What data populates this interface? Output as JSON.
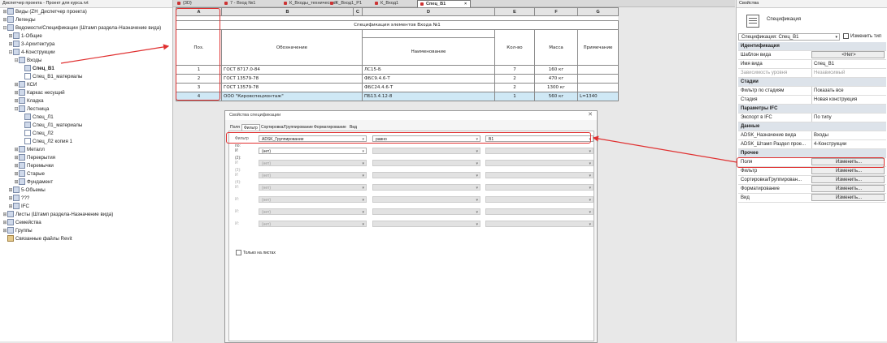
{
  "browser": {
    "title": "Диспетчер проекта - Проект для курса.rvt",
    "items": [
      {
        "label": "Виды (ZH_Диспетчер проекта)",
        "toggle": "⊞",
        "indent": 0
      },
      {
        "label": "Легенды",
        "toggle": "⊞",
        "indent": 0
      },
      {
        "label": "Ведомости/Спецификации (Штамп раздела-Назначение вида)",
        "toggle": "⊟",
        "indent": 0
      },
      {
        "label": "1-Общие",
        "toggle": "⊞",
        "indent": 1
      },
      {
        "label": "3-Архитектура",
        "toggle": "⊞",
        "indent": 1
      },
      {
        "label": "4-Конструкции",
        "toggle": "⊟",
        "indent": 1
      },
      {
        "label": "Входы",
        "toggle": "⊟",
        "indent": 2
      },
      {
        "label": "Спец_В1",
        "toggle": "",
        "indent": 3
      },
      {
        "label": "Спец_В1_материалы",
        "toggle": "",
        "indent": 3
      },
      {
        "label": "КСИ",
        "toggle": "⊞",
        "indent": 2
      },
      {
        "label": "Каркас несущий",
        "toggle": "⊞",
        "indent": 2
      },
      {
        "label": "Кладка",
        "toggle": "⊞",
        "indent": 2
      },
      {
        "label": "Лестница",
        "toggle": "⊟",
        "indent": 2
      },
      {
        "label": "Спец_Л1",
        "toggle": "",
        "indent": 3
      },
      {
        "label": "Спец_Л1_материалы",
        "toggle": "",
        "indent": 3
      },
      {
        "label": "Спец_Л2",
        "toggle": "",
        "indent": 3
      },
      {
        "label": "Спец_Л2 копия 1",
        "toggle": "",
        "indent": 3
      },
      {
        "label": "Металл",
        "toggle": "⊞",
        "indent": 2
      },
      {
        "label": "Перекрытия",
        "toggle": "⊞",
        "indent": 2
      },
      {
        "label": "Перемычки",
        "toggle": "⊞",
        "indent": 2
      },
      {
        "label": "Старые",
        "toggle": "⊞",
        "indent": 2
      },
      {
        "label": "Фундамент",
        "toggle": "⊞",
        "indent": 2
      },
      {
        "label": "5-Объемы",
        "toggle": "⊞",
        "indent": 1
      },
      {
        "label": "???",
        "toggle": "⊞",
        "indent": 1
      },
      {
        "label": "IFC",
        "toggle": "⊞",
        "indent": 1
      },
      {
        "label": "Листы (Штамп раздела-Назначение вида)",
        "toggle": "⊞",
        "indent": 0
      },
      {
        "label": "Семейства",
        "toggle": "⊞",
        "indent": 0
      },
      {
        "label": "Группы",
        "toggle": "⊞",
        "indent": 0
      },
      {
        "label": "Связанные файлы Revit",
        "toggle": "",
        "indent": 0
      }
    ]
  },
  "tabs": [
    {
      "label": "{3D}"
    },
    {
      "label": "7 - Вход №1"
    },
    {
      "label": "К_Входы_технический"
    },
    {
      "label": "К_Вход1_Р1"
    },
    {
      "label": "К_Вход1"
    },
    {
      "label": "Спец_В1",
      "active": true,
      "close": "×"
    }
  ],
  "schedule": {
    "letters": [
      "A",
      "B",
      "C",
      "D",
      "E",
      "F",
      "G"
    ],
    "title": "Спецификация элементов Входа №1",
    "headers": {
      "pos": "Поз.",
      "designation": "Обозначение",
      "name": "Наименование",
      "qty": "Кол-во",
      "mass": "Масса",
      "note": "Примечание"
    },
    "rows": [
      [
        "1",
        "ГОСТ 8717.0-84",
        "ЛС15-Б",
        "7",
        "160 кг",
        ""
      ],
      [
        "2",
        "ГОСТ 13579-78",
        "ФБС9.4.6-Т",
        "2",
        "470 кг",
        ""
      ],
      [
        "3",
        "ГОСТ 13579-78",
        "ФБС24.4.6-Т",
        "2",
        "1300 кг",
        ""
      ],
      [
        "4",
        "ООО \"Кировспецмонтаж\"",
        "ПБ13.4.12-8",
        "1",
        "560 кг",
        "L=1340"
      ]
    ]
  },
  "dialog": {
    "title": "Свойства спецификации",
    "close": "✕",
    "tabs": [
      "Поля",
      "Фильтр",
      "Сортировка/Группирование",
      "Форматирование",
      "Вид"
    ],
    "filters": [
      {
        "label": "Фильтр по:",
        "field": "ADSK_Группирование",
        "op": "равно",
        "value": "В1",
        "enabled": true
      },
      {
        "label": "И (2):",
        "field": "(нет)",
        "op": "",
        "value": "",
        "enabled": true
      },
      {
        "label": "И (3):",
        "field": "(нет)",
        "op": "",
        "value": "",
        "enabled": false
      },
      {
        "label": "И (4):",
        "field": "(нет)",
        "op": "",
        "value": "",
        "enabled": false
      },
      {
        "label": "И:",
        "field": "(нет)",
        "op": "",
        "value": "",
        "enabled": false
      },
      {
        "label": "И:",
        "field": "(нет)",
        "op": "",
        "value": "",
        "enabled": false
      },
      {
        "label": "И:",
        "field": "(нет)",
        "op": "",
        "value": "",
        "enabled": false
      },
      {
        "label": "И:",
        "field": "(нет)",
        "op": "",
        "value": "",
        "enabled": false
      }
    ],
    "only_sheets": "Только на листах"
  },
  "props": {
    "title": "Свойства",
    "type_name": "Спецификация",
    "selector": "Спецификация: Спец_В1",
    "edit_type": "Изменить тип",
    "rows": [
      {
        "group": "Идентификация"
      },
      {
        "k": "Шаблон вида",
        "v": "<Нет>",
        "btn": true
      },
      {
        "k": "Имя вида",
        "v": "Спец_В1"
      },
      {
        "k": "Зависимость уровня",
        "v": "Независимый",
        "dis": true
      },
      {
        "group": "Стадии"
      },
      {
        "k": "Фильтр по стадиям",
        "v": "Показать все"
      },
      {
        "k": "Стадия",
        "v": "Новая конструкция"
      },
      {
        "group": "Параметры IFC"
      },
      {
        "k": "Экспорт в IFC",
        "v": "По типу"
      },
      {
        "group": "Данные"
      },
      {
        "k": "ADSK_Назначение вида",
        "v": "Входы"
      },
      {
        "k": "ADSK_Штамп Раздел прое...",
        "v": "4-Конструкции"
      },
      {
        "group": "Прочее"
      },
      {
        "k": "Поля",
        "v": "Изменить...",
        "btn": true
      },
      {
        "k": "Фильтр",
        "v": "Изменить...",
        "btn": true
      },
      {
        "k": "Сортировка/Группирован...",
        "v": "Изменить...",
        "btn": true
      },
      {
        "k": "Форматирование",
        "v": "Изменить...",
        "btn": true
      },
      {
        "k": "Вид",
        "v": "Изменить...",
        "btn": true
      }
    ]
  },
  "colors": {
    "annotation": "#e03030",
    "highlight_row": "#cfe8f5"
  }
}
